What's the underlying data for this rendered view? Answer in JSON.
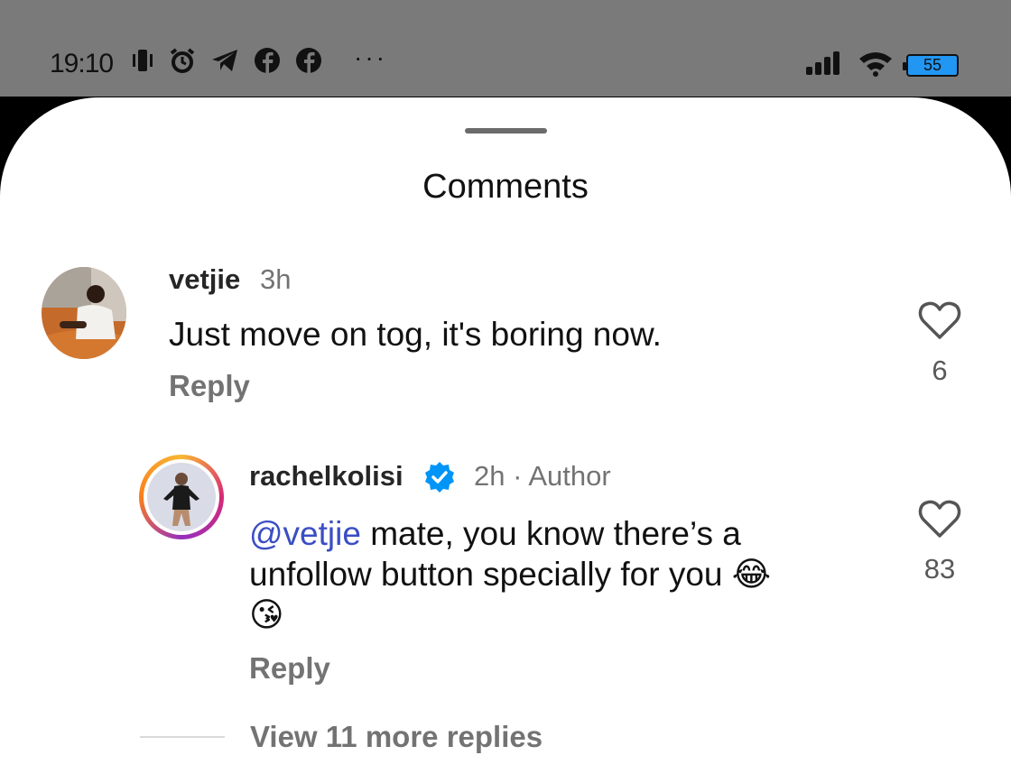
{
  "status_bar": {
    "time": "19:10",
    "icons_left": [
      "vibrate-icon",
      "alarm-icon",
      "telegram-icon",
      "facebook-icon",
      "facebook-icon"
    ],
    "more": "···",
    "battery": "55",
    "battery_level": 0.55
  },
  "sheet": {
    "title": "Comments"
  },
  "comments": [
    {
      "username": "vetjie",
      "time": "3h",
      "text": "Just move on tog, it's boring now.",
      "reply_label": "Reply",
      "like_count": "6"
    }
  ],
  "reply": {
    "username": "rachelkolisi",
    "verified": true,
    "time_author": "2h · Author",
    "mention": "@vetjie",
    "text_line1": " mate, you know there’s a",
    "text_line2": "unfollow button specially for you 😂",
    "text_line3": "😘",
    "reply_label": "Reply",
    "like_count": "83"
  },
  "view_more": "View 11 more replies",
  "colors": {
    "mention": "#3a4ec4",
    "verified": "#0095f6",
    "battery": "#2196f3"
  }
}
